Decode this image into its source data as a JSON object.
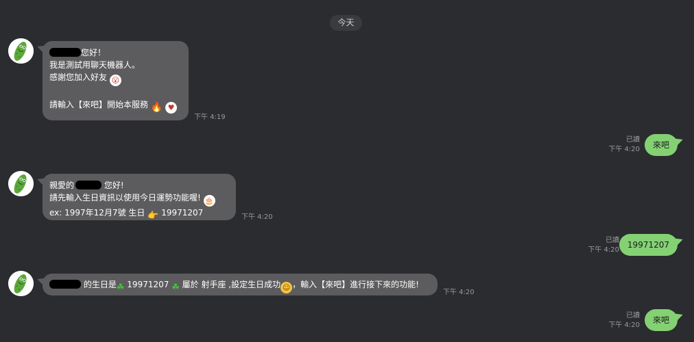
{
  "date_label": "今天",
  "incoming": [
    {
      "lines": [
        "您好！",
        "我是測試用聊天機器人。",
        "感謝您加入好友",
        "",
        "請輸入【來吧】開始本服務"
      ],
      "time": "下午 4:19"
    },
    {
      "line1_a": "親愛的",
      "line1_b": " 您好!",
      "line2": "請先輸入生日資訊以使用今日運勢功能喔!",
      "line3_a": "ex: 1997年12月7號 生日",
      "line3_b": " 19971207",
      "time": "下午 4:20"
    },
    {
      "text_a": " 的生日是",
      "text_b": " 19971207 ",
      "text_c": " 屬於 射手座 ,設定生日成功",
      "text_d": "，輸入【來吧】進行接下來的功能!",
      "time": "下午 4:20"
    }
  ],
  "outgoing": [
    {
      "text": "來吧",
      "read": "已讀",
      "time": "下午 4:20"
    },
    {
      "text": "19971207",
      "read": "已讀",
      "time": "下午 4:20"
    },
    {
      "text": "來吧",
      "read": "已讀",
      "time": "下午 4:20"
    }
  ],
  "icons": {
    "avatar": "pickle-avatar-icon",
    "fire": "🔥",
    "clover": "☘",
    "hand": "👉",
    "smile": "☺",
    "cake": "🎂",
    "surprised": "😮",
    "heart_eyes": "♥"
  },
  "colors": {
    "background": "#2b2c2f",
    "incoming_bubble": "#5c5c5e",
    "outgoing_bubble": "#84d174",
    "meta_text": "#9a9b9e"
  }
}
